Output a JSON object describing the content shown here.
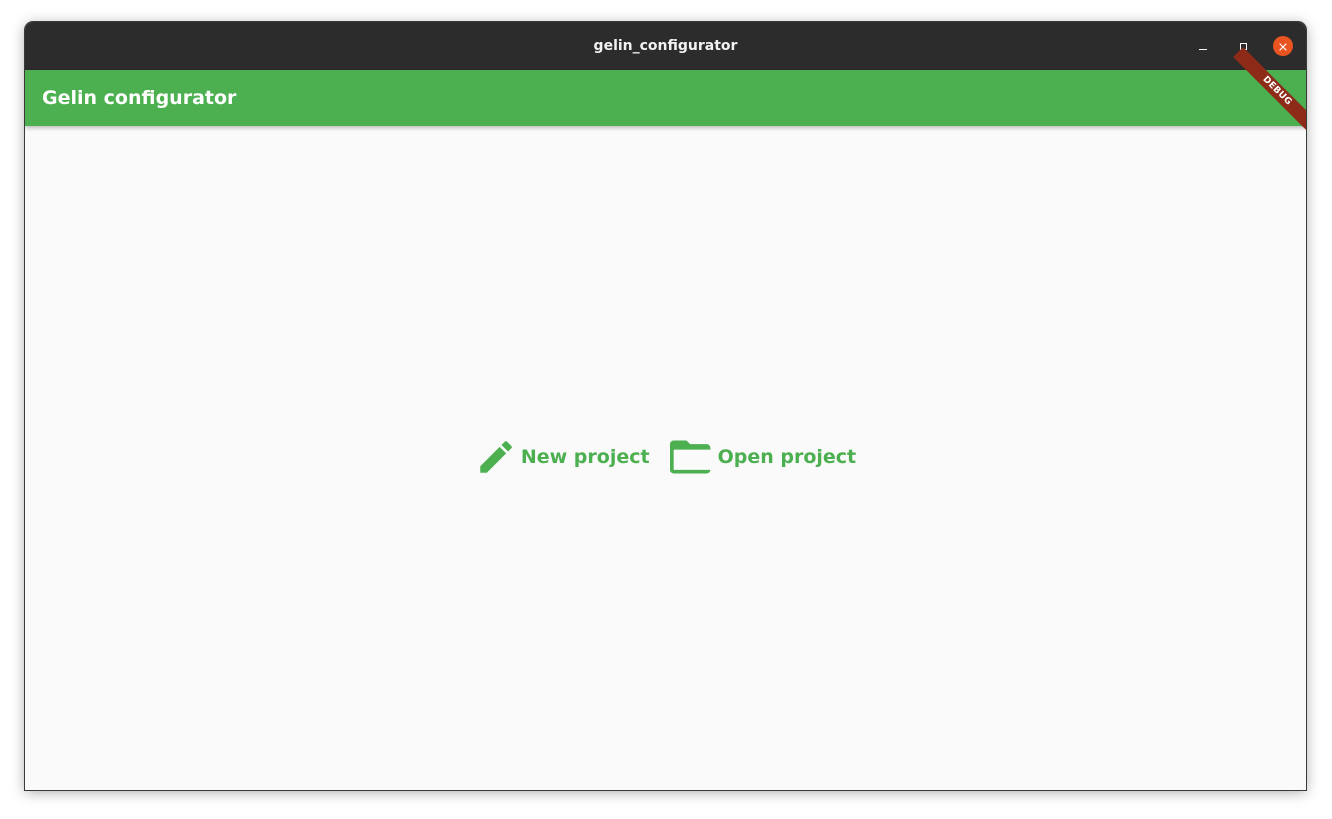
{
  "window": {
    "title": "gelin_configurator",
    "controls": {
      "minimize_icon": "minimize-icon",
      "maximize_icon": "maximize-icon",
      "close_icon": "close-icon"
    }
  },
  "appbar": {
    "title": "Gelin configurator",
    "color": "#4caf50",
    "debug_banner": "DEBUG",
    "debug_banner_color": "#8e2a18"
  },
  "actions": [
    {
      "label": "New project",
      "icon": "pencil-icon"
    },
    {
      "label": "Open project",
      "icon": "folder-icon"
    }
  ],
  "colors": {
    "accent": "#4caf50",
    "titlebar": "#2c2c2c",
    "close_button": "#e95420",
    "background": "#fafafa"
  }
}
